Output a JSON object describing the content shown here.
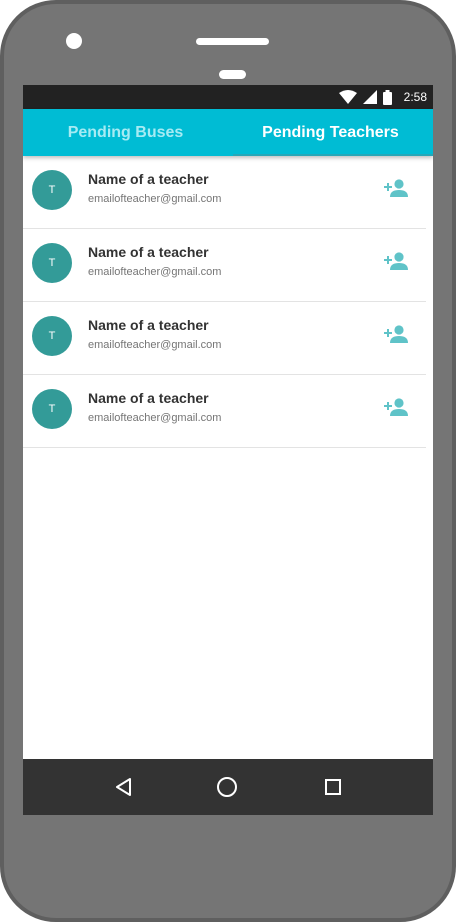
{
  "status_bar": {
    "time": "2:58",
    "icons": [
      "wifi-icon",
      "signal-icon",
      "battery-icon"
    ]
  },
  "tabs": [
    {
      "label": "Pending Buses",
      "selected": false
    },
    {
      "label": "Pending Teachers",
      "selected": true
    }
  ],
  "teachers": [
    {
      "initial": "T",
      "name": "Name of a teacher",
      "email": "emailofteacher@gmail.com"
    },
    {
      "initial": "T",
      "name": "Name of a teacher",
      "email": "emailofteacher@gmail.com"
    },
    {
      "initial": "T",
      "name": "Name of a teacher",
      "email": "emailofteacher@gmail.com"
    },
    {
      "initial": "T",
      "name": "Name of a teacher",
      "email": "emailofteacher@gmail.com"
    }
  ],
  "row_action_icon": "add-person-icon",
  "nav_bar": {
    "icons": [
      "back-icon",
      "home-icon",
      "recents-icon"
    ]
  },
  "colors": {
    "app_bar": "#00bcd4",
    "avatar": "#339b98",
    "add_icon": "#5fc3c8",
    "status_bar": "#222222",
    "nav_bar": "#333333",
    "device_frame": "#757575"
  }
}
